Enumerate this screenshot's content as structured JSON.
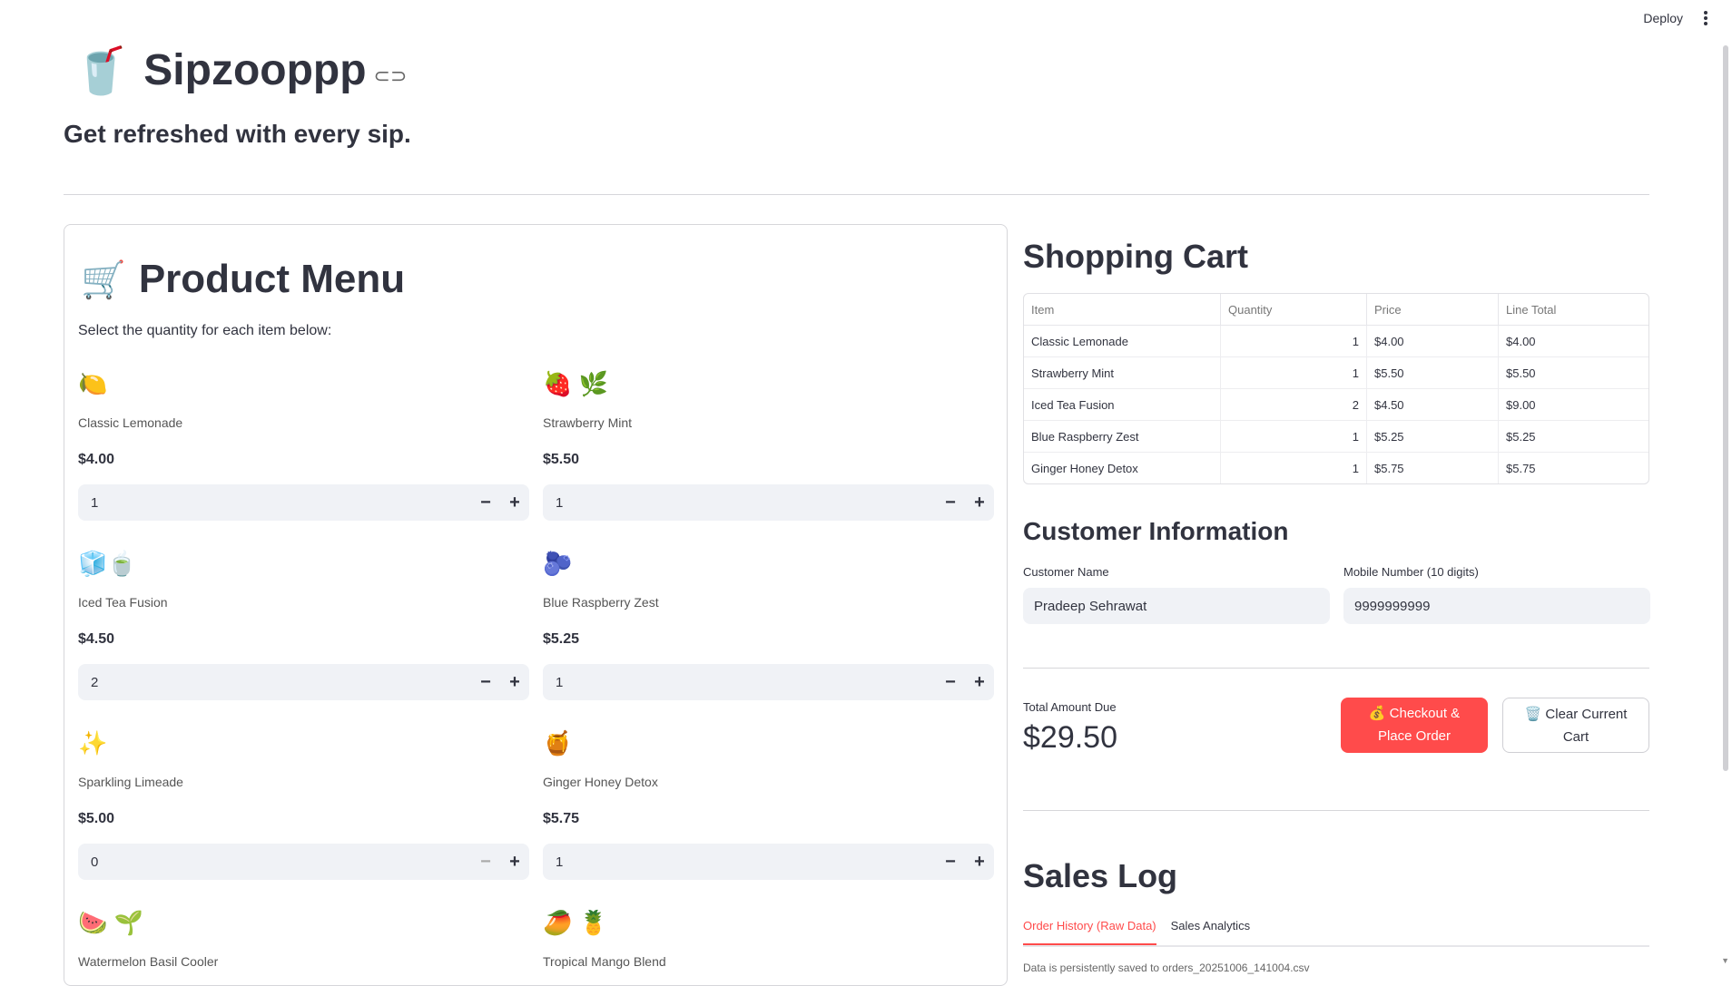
{
  "header": {
    "deploy_label": "Deploy"
  },
  "app": {
    "title_emoji": "🥤",
    "title": "Sipzooppp",
    "tagline": "Get refreshed with every sip."
  },
  "menu": {
    "emoji": "🛒",
    "title": "Product Menu",
    "subtitle": "Select the quantity for each item below:",
    "items": [
      {
        "emoji": "🍋",
        "name": "Classic Lemonade",
        "price": "$4.00",
        "qty": "1"
      },
      {
        "emoji": "🍓 🌿",
        "name": "Strawberry Mint",
        "price": "$5.50",
        "qty": "1"
      },
      {
        "emoji": "🧊🍵",
        "name": "Iced Tea Fusion",
        "price": "$4.50",
        "qty": "2"
      },
      {
        "emoji": "🫐",
        "name": "Blue Raspberry Zest",
        "price": "$5.25",
        "qty": "1"
      },
      {
        "emoji": "✨",
        "name": "Sparkling Limeade",
        "price": "$5.00",
        "qty": "0"
      },
      {
        "emoji": "🍯",
        "name": "Ginger Honey Detox",
        "price": "$5.75",
        "qty": "1"
      },
      {
        "emoji": "🍉 🌱",
        "name": "Watermelon Basil Cooler"
      },
      {
        "emoji": "🥭 🍍",
        "name": "Tropical Mango Blend"
      }
    ]
  },
  "cart": {
    "title": "Shopping Cart",
    "columns": [
      "Item",
      "Quantity",
      "Price",
      "Line Total"
    ],
    "rows": [
      [
        "Classic Lemonade",
        "1",
        "$4.00",
        "$4.00"
      ],
      [
        "Strawberry Mint",
        "1",
        "$5.50",
        "$5.50"
      ],
      [
        "Iced Tea Fusion",
        "2",
        "$4.50",
        "$9.00"
      ],
      [
        "Blue Raspberry Zest",
        "1",
        "$5.25",
        "$5.25"
      ],
      [
        "Ginger Honey Detox",
        "1",
        "$5.75",
        "$5.75"
      ]
    ]
  },
  "customer": {
    "title": "Customer Information",
    "name_label": "Customer Name",
    "name_value": "Pradeep Sehrawat",
    "mobile_label": "Mobile Number (10 digits)",
    "mobile_value": "9999999999"
  },
  "totals": {
    "label": "Total Amount Due",
    "value": "$29.50",
    "checkout_line1": "💰 Checkout &",
    "checkout_line2": "Place Order",
    "clear_line1": "🗑️ Clear Current",
    "clear_line2": "Cart"
  },
  "sales": {
    "title": "Sales Log",
    "tabs": [
      "Order History (Raw Data)",
      "Sales Analytics"
    ],
    "note": "Data is persistently saved to orders_20251006_141004.csv"
  },
  "colors": {
    "accent": "#ff4b4b",
    "input_bg": "#f0f2f6",
    "text": "#31333f"
  }
}
